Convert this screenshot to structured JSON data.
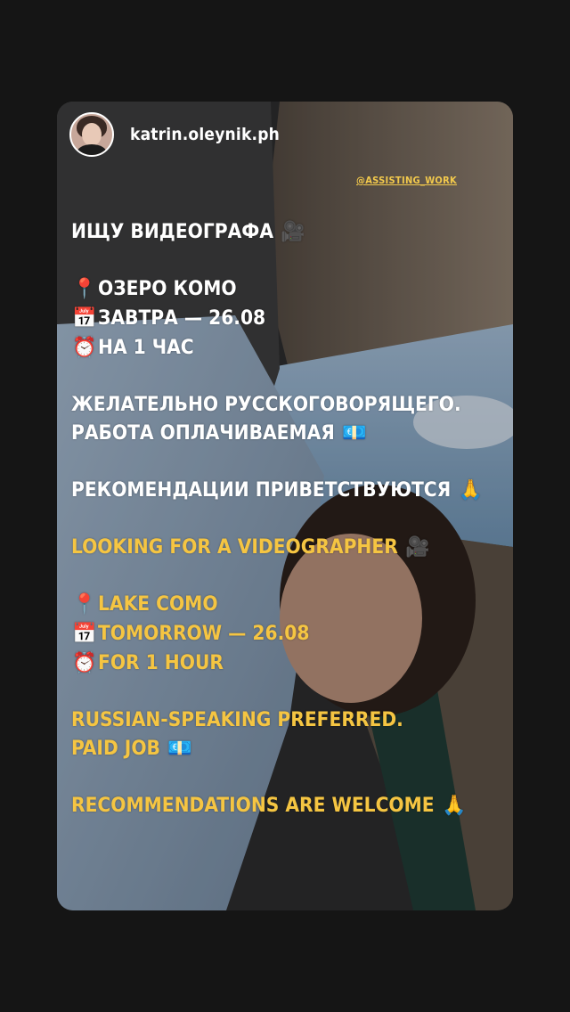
{
  "story": {
    "username": "katrin.oleynik.ph",
    "mention": "@ASSISTING_WORK"
  },
  "ru": {
    "title": "ИЩУ ВИДЕОГРАФА",
    "title_icon": "🎥",
    "location_icon": "📍",
    "location": "ОЗЕРО КОМО",
    "date_icon": "📅",
    "date": "ЗАВТРА — 26.08",
    "time_icon": "⏰",
    "time": "НА 1 ЧАС",
    "pref_line1": "ЖЕЛАТЕЛЬНО РУССКОГОВОРЯЩЕГО.",
    "pref_line2": "РАБОТА ОПЛАЧИВАЕМАЯ",
    "money_icon": "💶",
    "rec": "РЕКОМЕНДАЦИИ ПРИВЕТСТВУЮТСЯ",
    "pray_icon": "🙏"
  },
  "en": {
    "title": "LOOKING FOR A VIDEOGRAPHER",
    "title_icon": "🎥",
    "location_icon": "📍",
    "location": "LAKE COMO",
    "date_icon": "📅",
    "date": "TOMORROW — 26.08",
    "time_icon": "⏰",
    "time": "FOR 1 HOUR",
    "pref_line1": "RUSSIAN-SPEAKING PREFERRED.",
    "pref_line2": "PAID JOB",
    "money_icon": "💶",
    "rec": "RECOMMENDATIONS ARE WELCOME",
    "pray_icon": "🙏"
  },
  "colors": {
    "background": "#151515",
    "text_primary": "#ffffff",
    "text_accent": "#f5c542",
    "mention": "#f2c94c"
  }
}
